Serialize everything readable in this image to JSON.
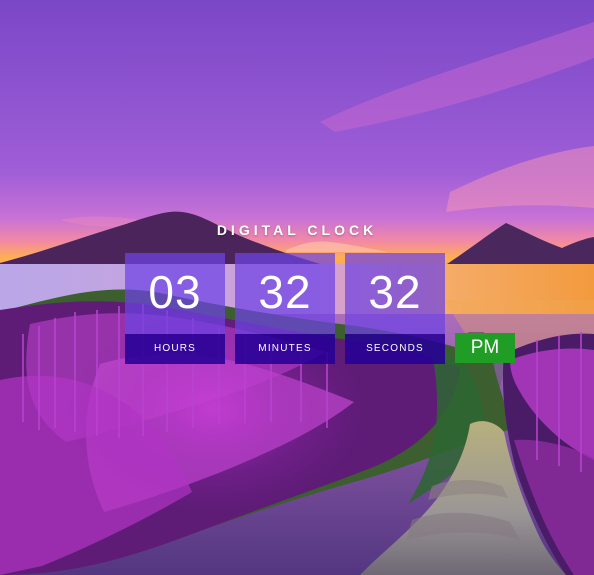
{
  "clock": {
    "title": "DIGITAL CLOCK",
    "hours": {
      "value": "03",
      "label": "HOURS"
    },
    "minutes": {
      "value": "32",
      "label": "MINUTES"
    },
    "seconds": {
      "value": "32",
      "label": "SECONDS"
    },
    "period": "PM"
  },
  "colors": {
    "unit_face": "#6e43e4",
    "unit_label_bar": "#270096",
    "period_badge": "#1f9d24",
    "text": "#ffffff"
  },
  "background": {
    "description_icon": "sunset-lake-volcano-flower-landscape"
  }
}
